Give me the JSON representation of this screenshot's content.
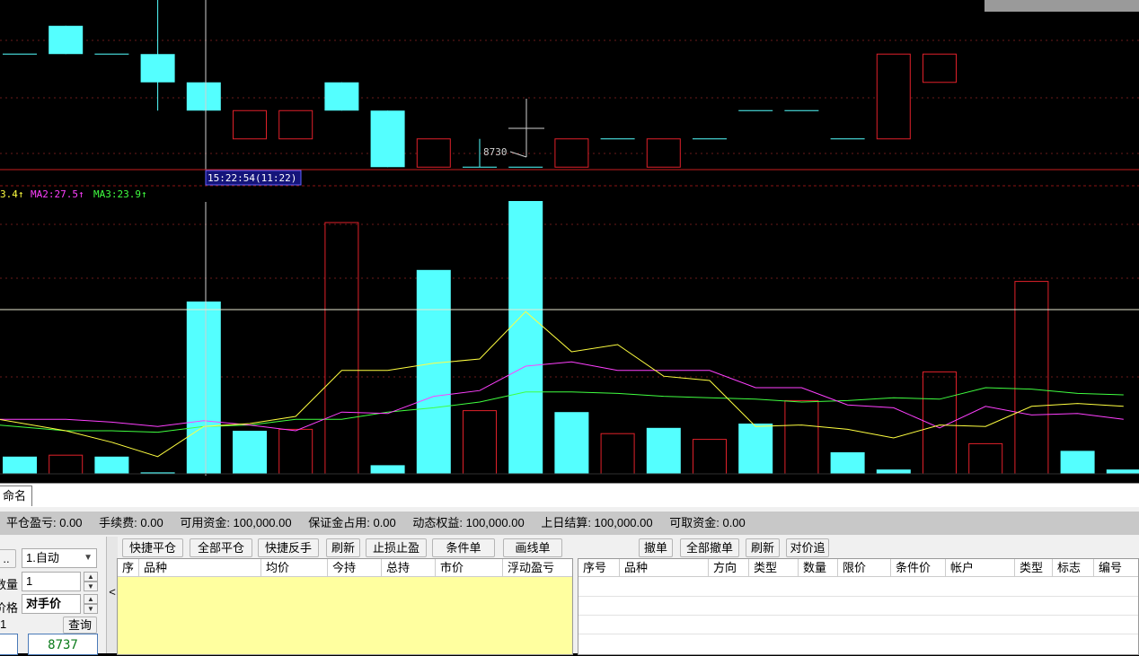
{
  "colors": {
    "up": "#e0212a",
    "down": "#54ffff",
    "ma1": "#ffff40",
    "ma2": "#ff40ff",
    "ma3": "#40ff40",
    "bg": "#000000"
  },
  "chart_data": {
    "type": "candlestick",
    "ohlc": [
      {
        "o": 8734,
        "c": 8734,
        "h": 8734,
        "l": 8734
      },
      {
        "o": 8735,
        "c": 8734,
        "h": 8735,
        "l": 8734
      },
      {
        "o": 8734,
        "c": 8734,
        "h": 8734,
        "l": 8734
      },
      {
        "o": 8734,
        "c": 8733,
        "h": 8736,
        "l": 8732
      },
      {
        "o": 8733,
        "c": 8732,
        "h": 8733,
        "l": 8732
      },
      {
        "o": 8731,
        "c": 8732,
        "h": 8732,
        "l": 8731
      },
      {
        "o": 8731,
        "c": 8732,
        "h": 8732,
        "l": 8731
      },
      {
        "o": 8733,
        "c": 8732,
        "h": 8733,
        "l": 8732
      },
      {
        "o": 8732,
        "c": 8730,
        "h": 8732,
        "l": 8730
      },
      {
        "o": 8730,
        "c": 8731,
        "h": 8731,
        "l": 8730
      },
      {
        "o": 8730,
        "c": 8730,
        "h": 8731,
        "l": 8730
      },
      {
        "o": 8730,
        "c": 8730,
        "h": 8730,
        "l": 8730
      },
      {
        "o": 8730,
        "c": 8731,
        "h": 8731,
        "l": 8730
      },
      {
        "o": 8731,
        "c": 8731,
        "h": 8731,
        "l": 8731
      },
      {
        "o": 8730,
        "c": 8731,
        "h": 8731,
        "l": 8730
      },
      {
        "o": 8731,
        "c": 8731,
        "h": 8731,
        "l": 8731
      },
      {
        "o": 8732,
        "c": 8732,
        "h": 8732,
        "l": 8732
      },
      {
        "o": 8732,
        "c": 8732,
        "h": 8732,
        "l": 8732
      },
      {
        "o": 8731,
        "c": 8731,
        "h": 8731,
        "l": 8731
      },
      {
        "o": 8731,
        "c": 8734,
        "h": 8734,
        "l": 8731
      },
      {
        "o": 8733,
        "c": 8734,
        "h": 8734,
        "l": 8733
      }
    ],
    "low_label": "8730",
    "volume": [
      12,
      13,
      12,
      1,
      120,
      30,
      31,
      175,
      6,
      142,
      44,
      190,
      43,
      28,
      32,
      24,
      35,
      51,
      15,
      3,
      71,
      21,
      134,
      16,
      3
    ],
    "volume_dir": [
      "down",
      "up",
      "down",
      "down",
      "down",
      "down",
      "up",
      "up",
      "down",
      "down",
      "up",
      "down",
      "down",
      "up",
      "down",
      "up",
      "down",
      "up",
      "down",
      "down",
      "up",
      "up",
      "up",
      "down",
      "down"
    ],
    "ma1": [
      38,
      30,
      22,
      12,
      33,
      35,
      40,
      72,
      72,
      77,
      80,
      113,
      85,
      90,
      68,
      65,
      33,
      34,
      31,
      25,
      34,
      33,
      47,
      49,
      47
    ],
    "ma2": [
      38,
      38,
      36,
      33,
      37,
      34,
      30,
      43,
      42,
      54,
      58,
      75,
      78,
      72,
      72,
      72,
      60,
      60,
      48,
      46,
      32,
      47,
      41,
      42,
      38
    ],
    "ma3": [
      34,
      30,
      30,
      29,
      33,
      34,
      38,
      38,
      43,
      46,
      50,
      57,
      57,
      56,
      54,
      53,
      52,
      50,
      51,
      53,
      52,
      60,
      59,
      56,
      55
    ],
    "ma_legend": [
      {
        "text": "3.4↑"
      },
      {
        "text": "MA2:27.5↑"
      },
      {
        "text": "MA3:23.9↑"
      }
    ],
    "time_label": "15:22:54(11:22)"
  },
  "tabs": {
    "active": "命名"
  },
  "status": [
    "平仓盈亏: 0.00",
    "手续费: 0.00",
    "可用资金: 100,000.00",
    "保证金占用: 0.00",
    "动态权益: 100,000.00",
    "上日结算: 100,000.00",
    "可取资金: 0.00"
  ],
  "order": {
    "dots": "..",
    "mode": "1.自动",
    "qty_label": "数量",
    "qty": "1",
    "price_label": "价格",
    "price": "对手价",
    "one": "1",
    "query": "查询",
    "quote": "8737",
    "collapse": "<"
  },
  "positions": {
    "buttons": [
      "快捷平仓",
      "全部平仓",
      "快捷反手",
      "刷新",
      "止损止盈",
      "条件单",
      "画线单"
    ],
    "columns": [
      "序",
      "品种",
      "均价",
      "今持",
      "总持",
      "市价",
      "浮动盈亏"
    ]
  },
  "orders": {
    "buttons": [
      "撤单",
      "全部撤单",
      "刷新",
      "对价追"
    ],
    "columns": [
      "序号",
      "品种",
      "方向",
      "类型",
      "数量",
      "限价",
      "条件价",
      "帐户",
      "类型",
      "标志",
      "编号"
    ]
  }
}
